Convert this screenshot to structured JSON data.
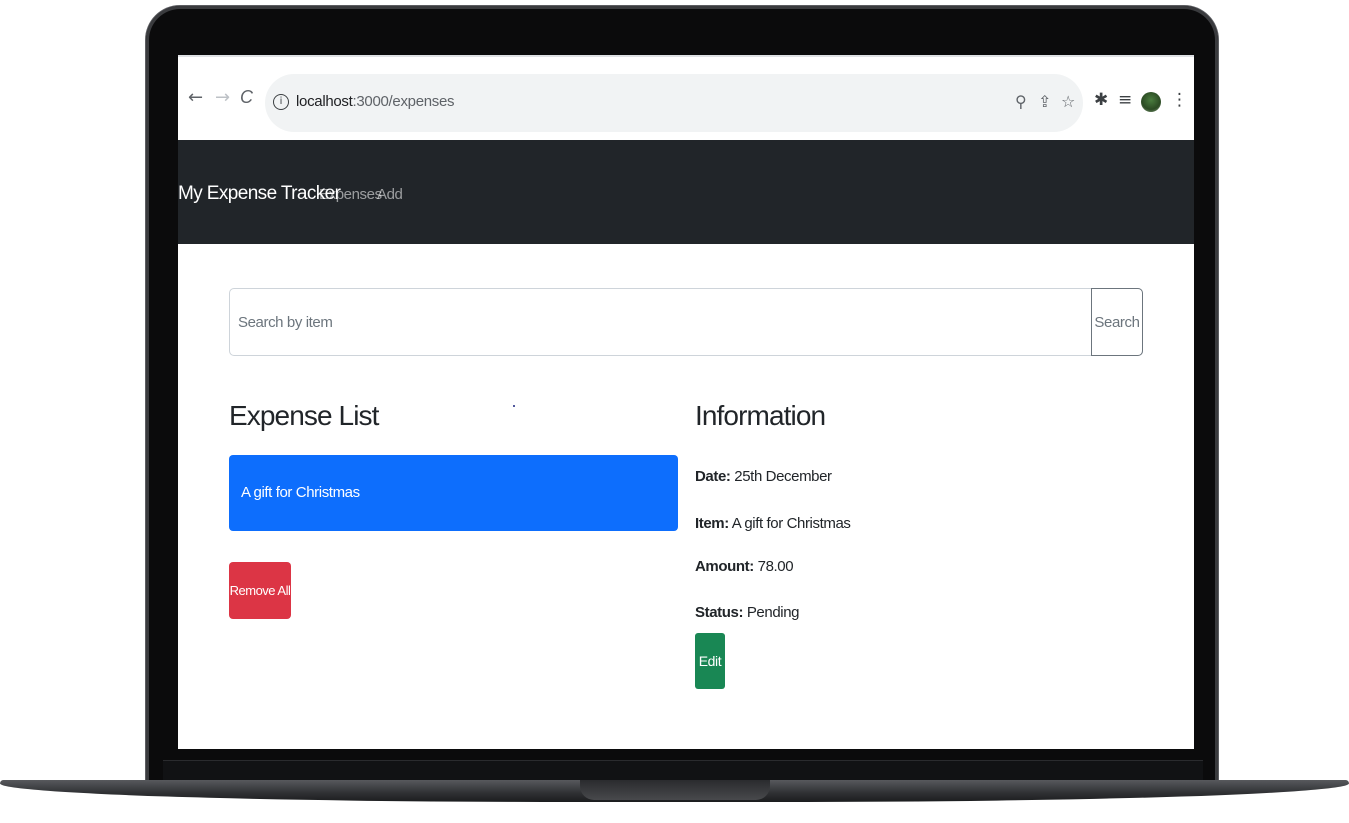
{
  "browser": {
    "url_host": "localhost",
    "url_path": ":3000/expenses",
    "icons": {
      "back": "←",
      "forward": "→",
      "reload": "C",
      "info": "i",
      "zoom": "⚲",
      "share": "⇪",
      "bookmark": "☆",
      "extensions": "✱",
      "reading_list": "≡",
      "menu": "⋮"
    }
  },
  "navbar": {
    "brand": "My Expense Tracker",
    "links": [
      "Expenses",
      "Add"
    ]
  },
  "search": {
    "placeholder": "Search by item",
    "button_label": "Search"
  },
  "expense_list": {
    "heading": "Expense List",
    "items": [
      {
        "label": "A gift for Christmas",
        "active": true
      }
    ],
    "remove_all_label": "Remove All"
  },
  "information": {
    "heading": "Information",
    "date_label": "Date:",
    "date_value": "25th December",
    "item_label": "Item:",
    "item_value": "A gift for Christmas",
    "amount_label": "Amount:",
    "amount_value": "78.00",
    "status_label": "Status:",
    "status_value": "Pending",
    "edit_label": "Edit"
  },
  "colors": {
    "navbar_bg": "#212529",
    "active_item": "#0d6efd",
    "danger": "#dc3545",
    "success": "#198754"
  }
}
